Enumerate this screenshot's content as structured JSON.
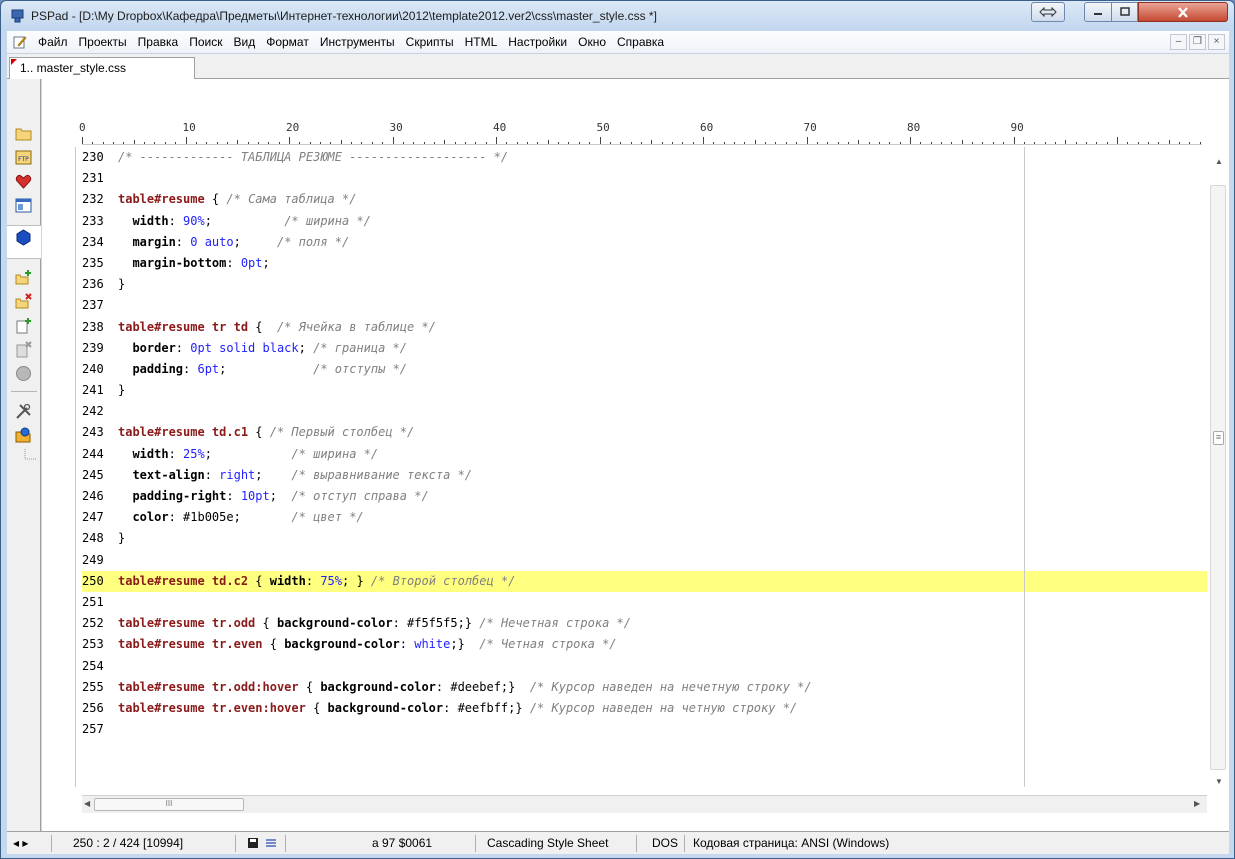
{
  "window": {
    "title": "PSPad - [D:\\My Dropbox\\Кафедра\\Предметы\\Интернет-технологии\\2012\\template2012.ver2\\css\\master_style.css *]"
  },
  "menu": {
    "items": [
      "Файл",
      "Проекты",
      "Правка",
      "Поиск",
      "Вид",
      "Формат",
      "Инструменты",
      "Скрипты",
      "HTML",
      "Настройки",
      "Окно",
      "Справка"
    ]
  },
  "tabs": [
    {
      "label": "1.. master_style.css"
    }
  ],
  "ruler": {
    "labels": [
      "0",
      "10",
      "20",
      "30",
      "40",
      "50",
      "60",
      "70",
      "80",
      "90"
    ]
  },
  "code": {
    "highlighted_line": "250",
    "lines": [
      {
        "n": "230",
        "tokens": [
          [
            "cmt",
            "/* ------------- ТАБЛИЦА РЕЗЮМЕ ------------------- */"
          ]
        ]
      },
      {
        "n": "231",
        "tokens": []
      },
      {
        "n": "232",
        "tokens": [
          [
            "sel",
            "table#resume"
          ],
          [
            "punc",
            " { "
          ],
          [
            "cmt",
            "/* Сама таблица */"
          ]
        ]
      },
      {
        "n": "233",
        "tokens": [
          [
            "prop",
            "  width"
          ],
          [
            "punc",
            ": "
          ],
          [
            "val",
            "90%"
          ],
          [
            "punc",
            ";          "
          ],
          [
            "cmt",
            "/* ширина */"
          ]
        ]
      },
      {
        "n": "234",
        "tokens": [
          [
            "prop",
            "  margin"
          ],
          [
            "punc",
            ": "
          ],
          [
            "val",
            "0 auto"
          ],
          [
            "punc",
            ";     "
          ],
          [
            "cmt",
            "/* поля */"
          ]
        ]
      },
      {
        "n": "235",
        "tokens": [
          [
            "prop",
            "  margin-bottom"
          ],
          [
            "punc",
            ": "
          ],
          [
            "val",
            "0pt"
          ],
          [
            "punc",
            ";"
          ]
        ]
      },
      {
        "n": "236",
        "tokens": [
          [
            "punc",
            "}"
          ]
        ]
      },
      {
        "n": "237",
        "tokens": []
      },
      {
        "n": "238",
        "tokens": [
          [
            "sel",
            "table#resume tr td"
          ],
          [
            "punc",
            " {  "
          ],
          [
            "cmt",
            "/* Ячейка в таблице */"
          ]
        ]
      },
      {
        "n": "239",
        "tokens": [
          [
            "prop",
            "  border"
          ],
          [
            "punc",
            ": "
          ],
          [
            "val",
            "0pt solid black"
          ],
          [
            "punc",
            "; "
          ],
          [
            "cmt",
            "/* граница */"
          ]
        ]
      },
      {
        "n": "240",
        "tokens": [
          [
            "prop",
            "  padding"
          ],
          [
            "punc",
            ": "
          ],
          [
            "val",
            "6pt"
          ],
          [
            "punc",
            ";            "
          ],
          [
            "cmt",
            "/* отступы */"
          ]
        ]
      },
      {
        "n": "241",
        "tokens": [
          [
            "punc",
            "}"
          ]
        ]
      },
      {
        "n": "242",
        "tokens": []
      },
      {
        "n": "243",
        "tokens": [
          [
            "sel",
            "table#resume td.c1"
          ],
          [
            "punc",
            " { "
          ],
          [
            "cmt",
            "/* Первый столбец */"
          ]
        ]
      },
      {
        "n": "244",
        "tokens": [
          [
            "prop",
            "  width"
          ],
          [
            "punc",
            ": "
          ],
          [
            "val",
            "25%"
          ],
          [
            "punc",
            ";           "
          ],
          [
            "cmt",
            "/* ширина */"
          ]
        ]
      },
      {
        "n": "245",
        "tokens": [
          [
            "prop",
            "  text-align"
          ],
          [
            "punc",
            ": "
          ],
          [
            "val",
            "right"
          ],
          [
            "punc",
            ";    "
          ],
          [
            "cmt",
            "/* выравнивание текста */"
          ]
        ]
      },
      {
        "n": "246",
        "tokens": [
          [
            "prop",
            "  padding-right"
          ],
          [
            "punc",
            ": "
          ],
          [
            "val",
            "10pt"
          ],
          [
            "punc",
            ";  "
          ],
          [
            "cmt",
            "/* отступ справа */"
          ]
        ]
      },
      {
        "n": "247",
        "tokens": [
          [
            "prop",
            "  color"
          ],
          [
            "punc",
            ": #1b005e;       "
          ],
          [
            "cmt",
            "/* цвет */"
          ]
        ]
      },
      {
        "n": "248",
        "tokens": [
          [
            "punc",
            "}"
          ]
        ]
      },
      {
        "n": "249",
        "tokens": []
      },
      {
        "n": "250",
        "tokens": [
          [
            "sel",
            "table#resume td.c2"
          ],
          [
            "punc",
            " { "
          ],
          [
            "prop",
            "width"
          ],
          [
            "punc",
            ": "
          ],
          [
            "val",
            "75%"
          ],
          [
            "punc",
            "; } "
          ],
          [
            "cmt",
            "/* Второй столбец */"
          ]
        ]
      },
      {
        "n": "251",
        "tokens": []
      },
      {
        "n": "252",
        "tokens": [
          [
            "sel",
            "table#resume tr.odd"
          ],
          [
            "punc",
            " { "
          ],
          [
            "prop",
            "background-color"
          ],
          [
            "punc",
            ": #f5f5f5;} "
          ],
          [
            "cmt",
            "/* Нечетная строка */"
          ]
        ]
      },
      {
        "n": "253",
        "tokens": [
          [
            "sel",
            "table#resume tr.even"
          ],
          [
            "punc",
            " { "
          ],
          [
            "prop",
            "background-color"
          ],
          [
            "punc",
            ": "
          ],
          [
            "val",
            "white"
          ],
          [
            "punc",
            ";}  "
          ],
          [
            "cmt",
            "/* Четная строка */"
          ]
        ]
      },
      {
        "n": "254",
        "tokens": []
      },
      {
        "n": "255",
        "tokens": [
          [
            "sel",
            "table#resume tr.odd:hover"
          ],
          [
            "punc",
            " { "
          ],
          [
            "prop",
            "background-color"
          ],
          [
            "punc",
            ": #deebef;}  "
          ],
          [
            "cmt",
            "/* Курсор наведен на нечетную строку */"
          ]
        ]
      },
      {
        "n": "256",
        "tokens": [
          [
            "sel",
            "table#resume tr.even:hover"
          ],
          [
            "punc",
            " { "
          ],
          [
            "prop",
            "background-color"
          ],
          [
            "punc",
            ": #eefbff;} "
          ],
          [
            "cmt",
            "/* Курсор наведен на четную строку */"
          ]
        ]
      },
      {
        "n": "257",
        "tokens": []
      }
    ]
  },
  "scrollbar": {
    "hthumb_grip": "III",
    "vthumb_grip": "≡"
  },
  "status": {
    "position": "250 : 2 / 424  [10994]",
    "char": "a  97  $0061",
    "syntax": "Cascading Style Sheet",
    "line_endings": "DOS",
    "codepage": "Кодовая страница: ANSI (Windows)"
  },
  "colors": {
    "selector": "#8b1a1a",
    "value": "#1f1fff",
    "comment": "#808080",
    "highlight": "#ffff80"
  }
}
